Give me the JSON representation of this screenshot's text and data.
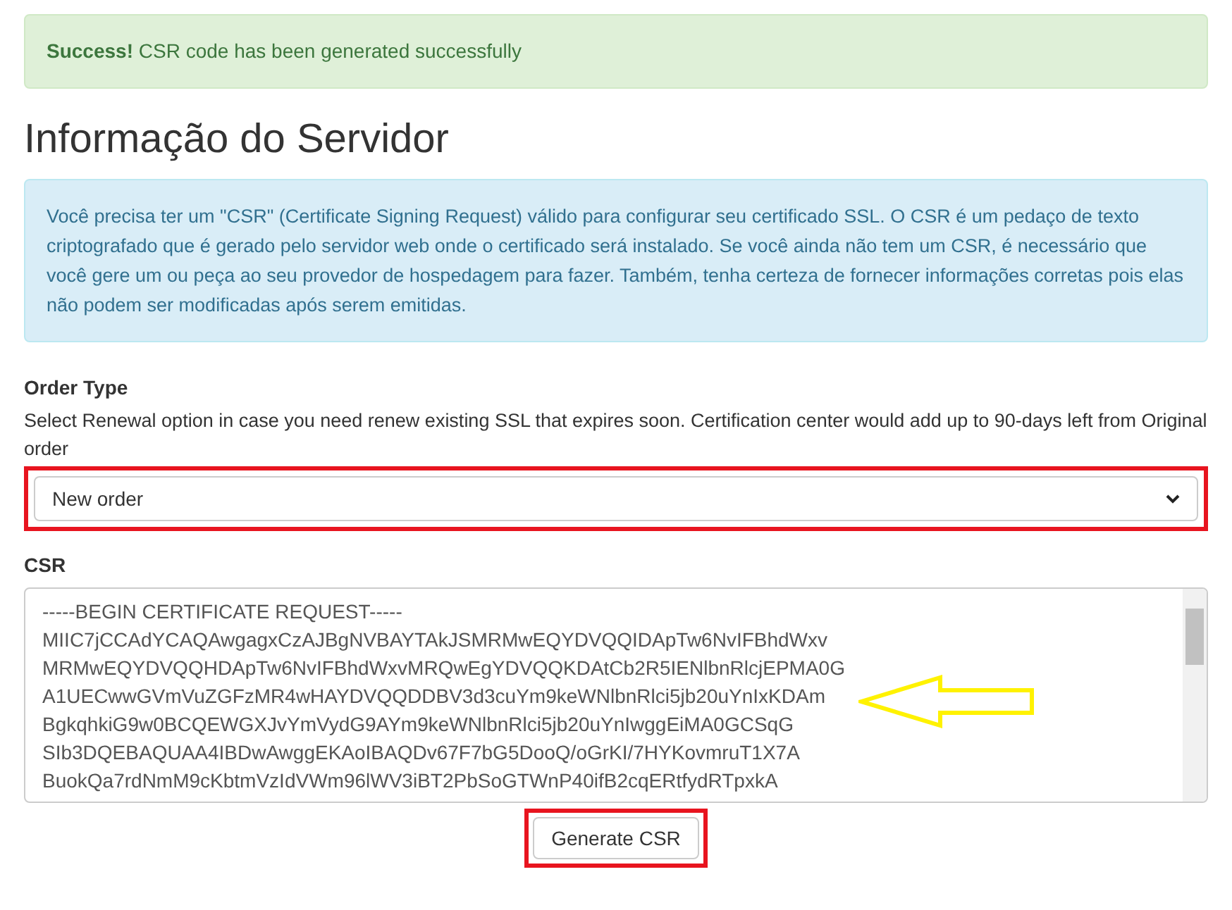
{
  "alert": {
    "text": "**Success!** CSR code has been generated successfully"
  },
  "heading": "Informação do Servidor",
  "info": "Você precisa ter um \"CSR\" (Certificate Signing Request) válido para configurar seu certificado SSL. O CSR é um pedaço de texto criptografado que é gerado pelo servidor web onde o certificado será instalado. Se você ainda não tem um CSR, é necessário que você gere um ou peça ao seu provedor de hospedagem para fazer. Também, tenha certeza de fornecer informações corretas pois elas não podem ser modificadas após serem emitidas.",
  "order_type": {
    "label": "Order Type",
    "help": "Select Renewal option in case you need renew existing SSL that expires soon. Certification center would add up to 90-days left from Original order",
    "value": "New order"
  },
  "csr": {
    "label": "CSR",
    "lines": [
      "-----BEGIN CERTIFICATE REQUEST-----",
      "MIIC7jCCAdYCAQAwgagxCzAJBgNVBAYTAkJSMRMwEQYDVQQIDApTw6NvIFBhdWxv",
      "MRMwEQYDVQQHDApTw6NvIFBhdWxvMRQwEgYDVQQKDAtCb2R5IENlbnRlcjEPMA0G",
      "A1UECwwGVmVuZGFzMR4wHAYDVQQDDBV3d3cuYm9keWNlbnRlci5jb20uYnIxKDAm",
      "BgkqhkiG9w0BCQEWGXJvYmVydG9AYm9keWNlbnRlci5jb20uYnIwggEiMA0GCSqG",
      "SIb3DQEBAQUAA4IBDwAwggEKAoIBAQDv67F7bG5DooQ/oGrKI/7HYKovmruT1X7A",
      "BuokQa7rdNmM9cKbtmVzIdVWm96lWV3iBT2PbSoGTWnP40ifB2cqERtfydRTpxkA"
    ]
  },
  "button": "Generate CSR"
}
